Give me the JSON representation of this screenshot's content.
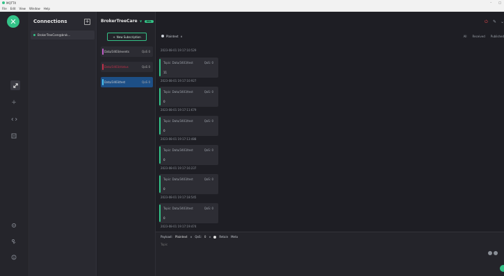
{
  "app": {
    "title": "MQTTX"
  },
  "menu": [
    "File",
    "Edit",
    "View",
    "Window",
    "Help"
  ],
  "window_controls": [
    "–",
    "□"
  ],
  "sidebar": {
    "logo_glyph": "✕",
    "icons": [
      "connections-icon",
      "new-connection-icon",
      "script-icon",
      "log-icon",
      "settings-icon",
      "about-icon",
      "info-icon"
    ]
  },
  "connections": {
    "header": "Connections",
    "add_glyph": "+",
    "items": [
      {
        "label": "BrokerTreeCare@brok...",
        "status": "connected"
      }
    ]
  },
  "broker": {
    "name": "BrokerTreeCare",
    "badge": "SSL",
    "chevron": "∨"
  },
  "subscriptions": {
    "new_label": "New Subscription",
    "new_glyph": "+",
    "items": [
      {
        "topic": "Data/3403/events",
        "qos": "QoS 0",
        "color": "#c25ec9"
      },
      {
        "topic": "Data/3403/status",
        "qos": "QoS 0",
        "color": "#c2314a"
      },
      {
        "topic": "Data/3403/test",
        "qos": "QoS 0",
        "color": "#3c8ae6"
      }
    ]
  },
  "message_bar": {
    "format": "Plaintext",
    "filters": [
      "All",
      "Received",
      "Published"
    ]
  },
  "conn_controls": {
    "disconnect_glyph": "⏻",
    "edit_glyph": "✎",
    "more_glyph": "⌄"
  },
  "messages": {
    "first_time": "2023-08-01 19:17:10:529",
    "items": [
      {
        "topic": "Topic: Data/3403/test",
        "qos": "QoS: 0",
        "payload": "11",
        "time": "2023-08-01 19:17:10:927"
      },
      {
        "topic": "Topic: Data/3403/test",
        "qos": "QoS: 0",
        "payload": "0",
        "time": "2023-08-01 19:17:11:679"
      },
      {
        "topic": "Topic: Data/3403/test",
        "qos": "QoS: 0",
        "payload": "0",
        "time": "2023-08-01 19:17:13:488"
      },
      {
        "topic": "Topic: Data/3403/test",
        "qos": "QoS: 0",
        "payload": "0",
        "time": "2023-08-01 19:17:16:237"
      },
      {
        "topic": "Topic: Data/3403/test",
        "qos": "QoS: 0",
        "payload": "0",
        "time": "2023-08-01 19:17:18:545"
      },
      {
        "topic": "Topic: Data/3403/test",
        "qos": "QoS: 0",
        "payload": "0",
        "time": "2023-08-01 19:17:19:474"
      }
    ]
  },
  "compose": {
    "payload_label": "Payload:",
    "payload_format": "Plaintext",
    "qos_label": "QoS:",
    "qos_value": "0",
    "retain_label": "Retain",
    "meta_label": "Meta",
    "topic_placeholder": "Topic"
  },
  "colors": {
    "accent": "#34c388"
  }
}
